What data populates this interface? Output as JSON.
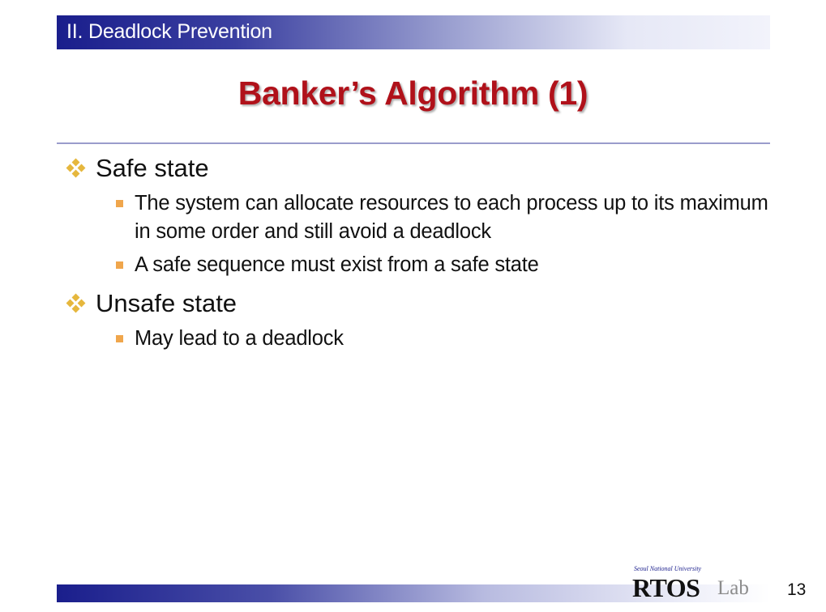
{
  "header": {
    "section_title": "II. Deadlock Prevention"
  },
  "slide": {
    "title": "Banker’s Algorithm (1)",
    "bullets": [
      {
        "label": "Safe state",
        "subitems": [
          "The system can allocate resources to each process up to its maximum in some order and still avoid a deadlock",
          "A safe sequence must exist from a safe state"
        ]
      },
      {
        "label": "Unsafe state",
        "subitems": [
          "May lead to a deadlock"
        ]
      }
    ]
  },
  "footer": {
    "logo_caption": "Seoul National University",
    "logo_main": "RTOS",
    "logo_suffix": "Lab",
    "page_number": "13"
  },
  "colors": {
    "title": "#b0111a",
    "header_bar_start": "#1a1e8c",
    "bullet_level1": "#e6b73d",
    "bullet_level2": "#f0a64c",
    "divider": "#9a9ccc"
  },
  "icons": {
    "level1_bullet": "four-diamond-icon",
    "level2_bullet": "square-bullet-icon"
  }
}
